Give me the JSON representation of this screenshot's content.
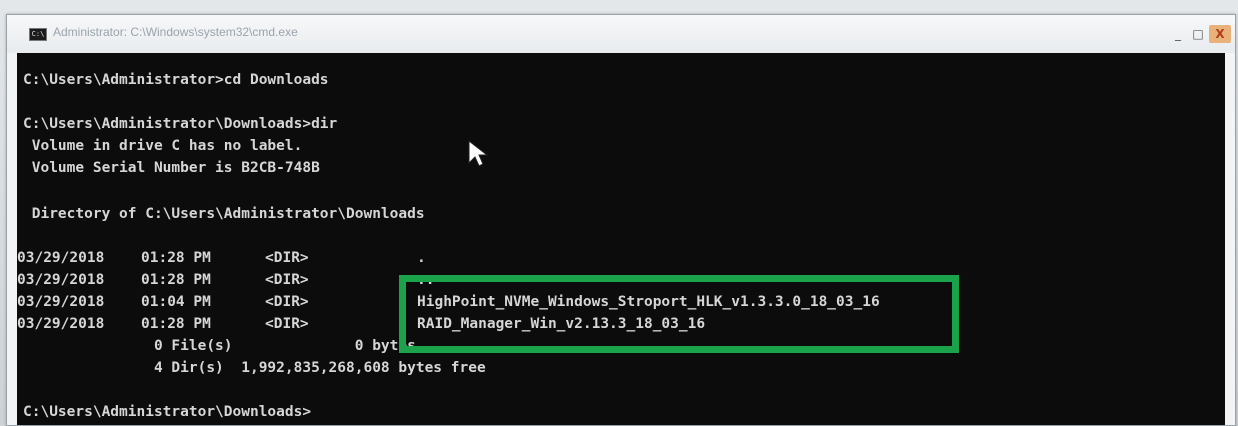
{
  "window": {
    "title": "Administrator: C:\\Windows\\system32\\cmd.exe",
    "icon": "cmd-icon",
    "controls": {
      "minimize": "_",
      "maximize": "□",
      "close": "X"
    }
  },
  "console": {
    "lines": [
      "C:\\Users\\Administrator>cd Downloads",
      "C:\\Users\\Administrator\\Downloads>dir",
      " Volume in drive C has no label.",
      " Volume Serial Number is B2CB-748B",
      " Directory of C:\\Users\\Administrator\\Downloads",
      "               0 File(s)              0 bytes",
      "               4 Dir(s)  1,992,835,268,608 bytes free",
      "C:\\Users\\Administrator\\Downloads>"
    ],
    "listing": [
      {
        "date": "03/29/2018",
        "time": "01:28 PM",
        "type": "<DIR>",
        "name": "."
      },
      {
        "date": "03/29/2018",
        "time": "01:28 PM",
        "type": "<DIR>",
        "name": ".."
      },
      {
        "date": "03/29/2018",
        "time": "01:04 PM",
        "type": "<DIR>",
        "name": "HighPoint_NVMe_Windows_Stroport_HLK_v1.3.3.0_18_03_16"
      },
      {
        "date": "03/29/2018",
        "time": "01:28 PM",
        "type": "<DIR>",
        "name": "RAID_Manager_Win_v2.13.3_18_03_16"
      }
    ]
  },
  "colors": {
    "console_bg": "#0c0c0c",
    "console_text": "#d6d6d6",
    "highlight": "#1aa34a"
  }
}
